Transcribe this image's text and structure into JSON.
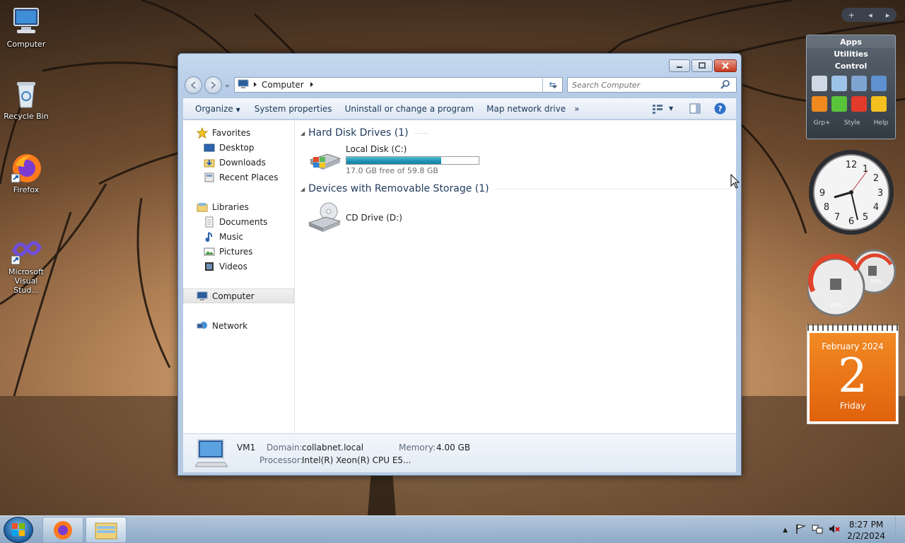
{
  "desktop": {
    "icons": [
      {
        "label": "Computer",
        "icon": "computer-icon"
      },
      {
        "label": "Recycle Bin",
        "icon": "recycle-bin-icon"
      },
      {
        "label": "Firefox",
        "icon": "firefox-icon"
      },
      {
        "label": "Microsoft Visual Stud...",
        "icon": "visual-studio-icon"
      }
    ]
  },
  "window": {
    "address": {
      "crumb": "Computer"
    },
    "search": {
      "placeholder": "Search Computer"
    },
    "toolbar": {
      "organize": "Organize",
      "system_properties": "System properties",
      "uninstall": "Uninstall or change a program",
      "map_drive": "Map network drive",
      "more": "»"
    },
    "nav": {
      "favorites": "Favorites",
      "desktop": "Desktop",
      "downloads": "Downloads",
      "recent": "Recent Places",
      "libraries": "Libraries",
      "documents": "Documents",
      "music": "Music",
      "pictures": "Pictures",
      "videos": "Videos",
      "computer": "Computer",
      "network": "Network"
    },
    "groups": {
      "hdd": {
        "title": "Hard Disk Drives (1)",
        "drive_name": "Local Disk (C:)",
        "free_text": "17.0 GB free of 59.8 GB",
        "used_fraction": 0.716
      },
      "removable": {
        "title": "Devices with Removable Storage (1)",
        "drive_name": "CD Drive (D:)"
      }
    },
    "details": {
      "name": "VM1",
      "domain_label": "Domain:",
      "domain": "collabnet.local",
      "memory_label": "Memory:",
      "memory": "4.00 GB",
      "processor_label": "Processor:",
      "processor": "Intel(R) Xeon(R) CPU E5..."
    }
  },
  "gadgets": {
    "apps_panel": {
      "tabs": [
        "Apps",
        "Utilities",
        "Control"
      ],
      "footer": [
        "Grp+",
        "Style",
        "Help"
      ]
    },
    "meters": {
      "cpu": "07%",
      "ram": "35%"
    },
    "calendar": {
      "month": "February 2024",
      "day": "2",
      "weekday": "Friday"
    }
  },
  "taskbar": {
    "time": "8:27 PM",
    "date": "2/2/2024"
  }
}
